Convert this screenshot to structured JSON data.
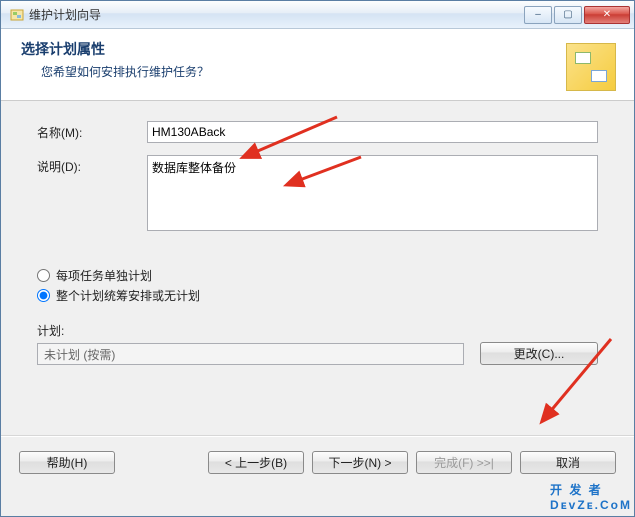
{
  "window": {
    "title": "维护计划向导"
  },
  "winbtns": {
    "min": "–",
    "max": "▢",
    "close": "✕"
  },
  "header": {
    "title": "选择计划属性",
    "subtitle": "您希望如何安排执行维护任务？"
  },
  "form": {
    "name_label": "名称(M):",
    "name_value": "HM130ABack",
    "desc_label": "说明(D):",
    "desc_value": "数据库整体备份"
  },
  "radios": {
    "opt1": "每项任务单独计划",
    "opt2": "整个计划统筹安排或无计划"
  },
  "plan": {
    "section_label": "计划:",
    "value": "未计划 (按需)",
    "change_btn": "更改(C)..."
  },
  "footer": {
    "help": "帮助(H)",
    "back": "< 上一步(B)",
    "next": "下一步(N) >",
    "finish": "完成(F) >>|",
    "cancel": "取消"
  },
  "overlay": {
    "line1": "开 发 者",
    "line2": "DᴇᴠZᴇ.CᴏM"
  }
}
